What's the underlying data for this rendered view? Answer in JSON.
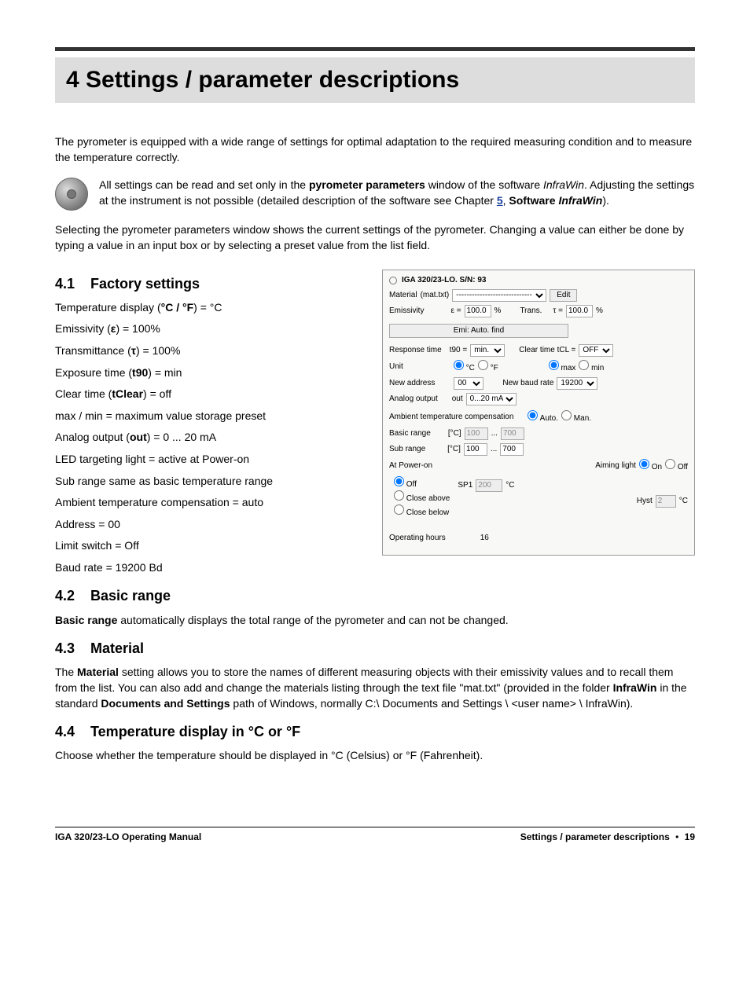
{
  "h1": "4  Settings / parameter descriptions",
  "intro": "The pyrometer is equipped with a wide range of settings for optimal adaptation to the required measuring condition and to measure the temperature correctly.",
  "note": {
    "line1a": "All settings can be read and set only in the ",
    "b1": "pyrometer parameters",
    "line1b": " window of the software ",
    "i1": "InfraWin",
    "line1c": ". Adjusting the settings at the instrument is not possible (detailed description of the software see Chapter ",
    "ch5": "5",
    "line1d": ", ",
    "b2": "Software ",
    "bi": "InfraWin",
    "line1e": ")."
  },
  "after_note": "Selecting the pyrometer parameters window shows the current settings of the pyrometer. Changing a value can either be done by typing a value in an input box or by selecting a preset value from the list field.",
  "s41": {
    "num": "4.1",
    "title": "Factory settings"
  },
  "fs": {
    "l1a": "Temperature display (",
    "l1b": "°C / °F",
    "l1c": ") = °C",
    "l2a": "Emissivity (",
    "l2s": "ε",
    "l2b": ") = 100%",
    "l3a": "Transmittance (",
    "l3s": "τ",
    "l3b": ") = 100%",
    "l4a": "Exposure time (",
    "l4b": "t90",
    "l4c": ") = min",
    "l5a": "Clear time (",
    "l5b": "tClear",
    "l5c": ") = off",
    "l6": "max / min = maximum value storage preset",
    "l7a": "Analog output (",
    "l7b": "out",
    "l7c": ") = 0 ... 20 mA",
    "l8": "LED targeting light = active at Power-on",
    "l9": "Sub range same as basic temperature range",
    "l10": "Ambient temperature compensation = auto",
    "l11": "Address = 00",
    "l12": "Limit switch = Off",
    "l13": "Baud rate = 19200 Bd"
  },
  "panel": {
    "title": "IGA 320/23-LO. S/N: 93",
    "material": "Material",
    "mattxt": "(mat.txt)",
    "edit": "Edit",
    "emiss": "Emissivity",
    "eps": "ε =",
    "epsv": "100.0",
    "pct": "%",
    "trans": "Trans.",
    "tau": "τ =",
    "tauv": "100.0",
    "autofind": "Emi: Auto. find",
    "resp": "Response time",
    "t90": "t90 =",
    "t90v": "min.",
    "clt": "Clear time  tCL =",
    "cltv": "OFF",
    "unit": "Unit",
    "uc": "°C",
    "uf": "°F",
    "max": "max",
    "min": "min",
    "naddr": "New address",
    "addrv": "00",
    "nbaud": "New baud rate",
    "baudv": "19200",
    "aout": "Analog output",
    "outl": "out",
    "aoutv": "0...20 mA",
    "atc": "Ambient temperature compensation",
    "auto": "Auto.",
    "man": "Man.",
    "brange": "Basic range",
    "degcl": "[°C]",
    "brlo": "100",
    "dots": "...",
    "brhi": "700",
    "srange": "Sub range",
    "srlo": "100",
    "srhi": "700",
    "pon": "At Power-on",
    "aim": "Aiming light",
    "on": "On",
    "off": "Off",
    "p_off": "Off",
    "p_ca": "Close above",
    "p_cb": "Close below",
    "sp1": "SP1",
    "sp1v": "200",
    "degc": "°C",
    "hyst": "Hyst",
    "hystv": "2",
    "oph": "Operating hours",
    "ophv": "16"
  },
  "s42": {
    "num": "4.2",
    "title": "Basic range"
  },
  "p42a": "Basic range",
  "p42b": " automatically displays the total range of the pyrometer and can not be changed.",
  "s43": {
    "num": "4.3",
    "title": "Material"
  },
  "p43a": "The ",
  "p43b": "Material",
  "p43c": " setting allows you to store the names of different measuring objects with their emissivity values and to recall them from the list. You can also add and change the materials listing through the text file \"mat.txt\" (provided in the folder ",
  "p43d": "InfraWin",
  "p43e": " in the standard ",
  "p43f": "Documents and Settings",
  "p43g": " path of Windows, normally C:\\ Documents and Settings \\ <user name> \\ InfraWin).",
  "s44": {
    "num": "4.4",
    "title": "Temperature display in °C or °F"
  },
  "p44": "Choose whether the temperature should be displayed in °C (Celsius) or °F (Fahrenheit).",
  "footer": {
    "left": "IGA 320/23-LO Operating Manual",
    "right": "Settings / parameter descriptions",
    "page": "19"
  }
}
